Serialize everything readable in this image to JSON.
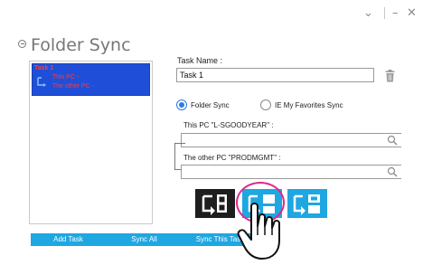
{
  "window": {
    "minimize_glyph": "–",
    "close_glyph": "✕",
    "chevron_glyph": "⌄"
  },
  "header": {
    "title": "Folder Sync"
  },
  "tasks": [
    {
      "name": "Task 1",
      "source": "This PC -",
      "target": "The other PC -"
    }
  ],
  "form": {
    "task_name_label": "Task Name :",
    "task_name_value": "Task 1",
    "mode_folder": "Folder Sync",
    "mode_ie": "IE My Favorites Sync",
    "this_pc_label": "This PC \"L-SGOODYEAR\" :",
    "other_pc_label": "The other PC \"PRODMGMT\" :",
    "this_pc_value": "",
    "other_pc_value": ""
  },
  "buttons": {
    "add_task": "Add Task",
    "sync_all": "Sync All",
    "sync_this_task": "Sync This Task"
  },
  "colors": {
    "accent": "#1ea7e1",
    "selection": "#1f4fd8",
    "task_text": "#ff3b3b",
    "highlight": "#e0288c"
  },
  "icons": [
    "chevron-down-icon",
    "minimize-icon",
    "close-icon",
    "back-icon",
    "trash-icon",
    "search-icon",
    "sync-direction-icon",
    "hand-cursor-icon"
  ]
}
